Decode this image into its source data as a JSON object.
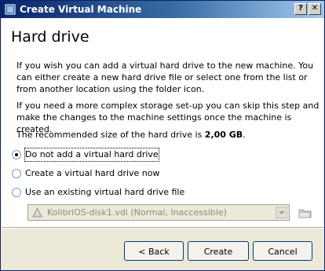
{
  "window": {
    "title": "Create Virtual Machine",
    "help_button": "?",
    "close_button": "✕"
  },
  "page": {
    "heading": "Hard drive",
    "intro": "If you wish you can add a virtual hard drive to the new machine. You can either create a new hard drive file or select one from the list or from another location using the folder icon.",
    "complex": "If you need a more complex storage set-up you can skip this step and make the changes to the machine settings once the machine is created.",
    "recommended_prefix": "The recommended size of the hard drive is ",
    "recommended_size": "2,00 GB",
    "recommended_suffix": "."
  },
  "options": {
    "no_disk": {
      "label": "Do not add a virtual hard drive",
      "selected": true
    },
    "create_now": {
      "label": "Create a virtual hard drive now",
      "selected": false
    },
    "use_existing": {
      "label": "Use an existing virtual hard drive file",
      "selected": false
    }
  },
  "existing_file": {
    "value": "KolibriOS-disk1.vdi (Normal, Inaccessible)",
    "enabled": false
  },
  "buttons": {
    "back": "< Back",
    "create": "Create",
    "cancel": "Cancel"
  }
}
